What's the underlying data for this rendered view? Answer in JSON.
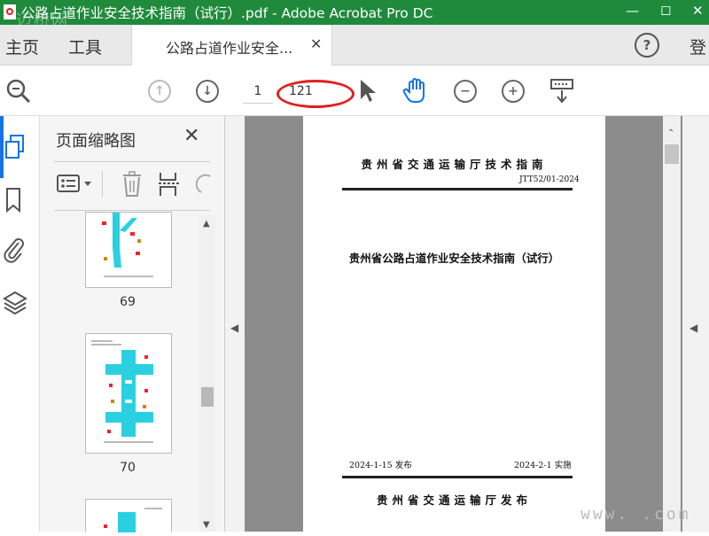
{
  "window": {
    "title": "公路占道作业安全技术指南（试行）.pdf - Adobe Acrobat Pro DC",
    "watermark": "迈桥网"
  },
  "menu": {
    "home": "主页",
    "tools": "工具",
    "doc_tab": "公路占道作业安全...",
    "login": "登"
  },
  "toolbar": {
    "current_page": "1",
    "total_pages": "121",
    "annotation_color": "#e02020"
  },
  "thumbnails": {
    "title": "页面缩略图",
    "pages": [
      "69",
      "70"
    ]
  },
  "document": {
    "header_org": "贵州省交通运输厅技术指南",
    "code": "JTT52/01-2024",
    "main_title": "贵州省公路占道作业安全技术指南（试行）",
    "publish_date": "2024-1-15 发布",
    "effective_date": "2024-2-1 实施",
    "issuer": "贵州省交通运输厅发布"
  },
  "bottom_watermark": "www.          .com"
}
